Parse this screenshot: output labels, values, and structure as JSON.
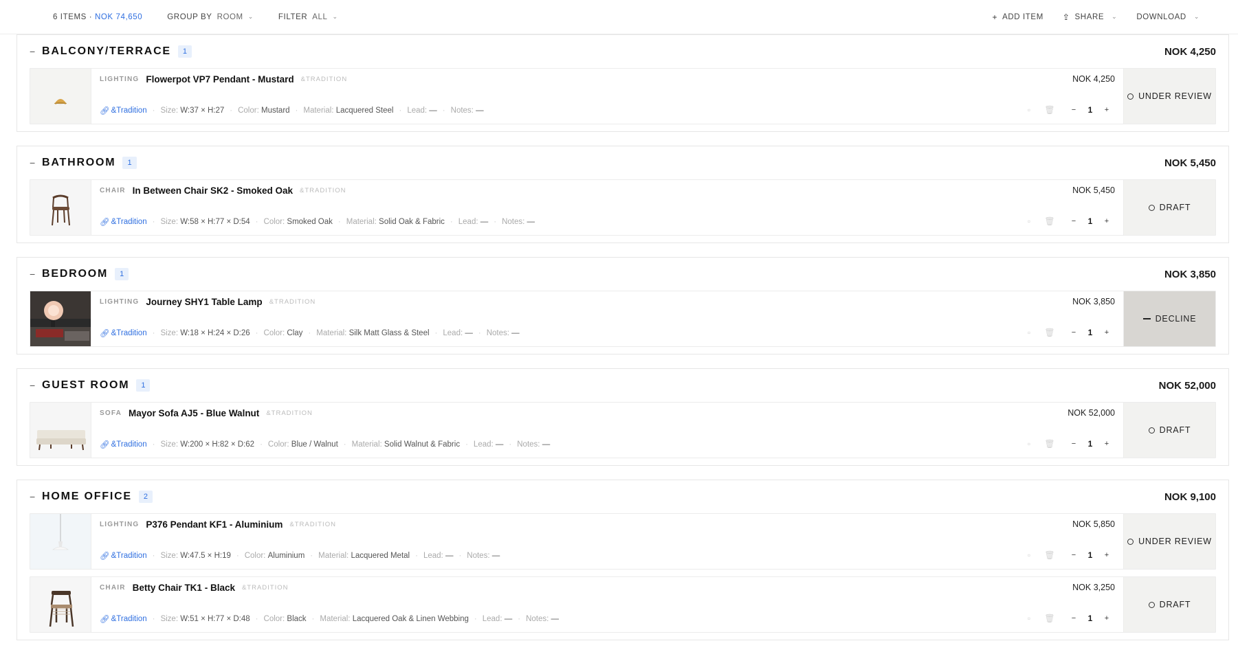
{
  "toolbar": {
    "count": "6 ITEMS · ",
    "total": "NOK 74,650",
    "group_label": "GROUP BY",
    "group_value": "ROOM",
    "filter_label": "FILTER",
    "filter_value": "ALL",
    "add_item": "ADD ITEM",
    "share": "SHARE",
    "download": "DOWNLOAD"
  },
  "rooms": [
    {
      "name": "BALCONY/TERRACE",
      "count": "1",
      "total": "NOK 4,250",
      "items": [
        {
          "category": "LIGHTING",
          "name": "Flowerpot VP7 Pendant - Mustard",
          "brand_tag": "&TRADITION",
          "price": "NOK 4,250",
          "brand": "&Tradition",
          "size": "W:37 × H:27",
          "color": "Mustard",
          "material": "Lacquered Steel",
          "lead": "—",
          "notes": "—",
          "qty": "1",
          "status": "UNDER REVIEW",
          "status_type": "dot",
          "thumb": "pendant-mustard"
        }
      ]
    },
    {
      "name": "BATHROOM",
      "count": "1",
      "total": "NOK 5,450",
      "items": [
        {
          "category": "CHAIR",
          "name": "In Between Chair SK2 - Smoked Oak",
          "brand_tag": "&TRADITION",
          "price": "NOK 5,450",
          "brand": "&Tradition",
          "size": "W:58 × H:77 × D:54",
          "color": "Smoked Oak",
          "material": "Solid Oak & Fabric",
          "lead": "—",
          "notes": "—",
          "qty": "1",
          "status": "DRAFT",
          "status_type": "dot",
          "thumb": "chair-oak"
        }
      ]
    },
    {
      "name": "BEDROOM",
      "count": "1",
      "total": "NOK 3,850",
      "items": [
        {
          "category": "LIGHTING",
          "name": "Journey SHY1 Table Lamp",
          "brand_tag": "&TRADITION",
          "price": "NOK 3,850",
          "brand": "&Tradition",
          "size": "W:18 × H:24 × D:26",
          "color": "Clay",
          "material": "Silk Matt Glass & Steel",
          "lead": "—",
          "notes": "—",
          "qty": "1",
          "status": "DECLINE",
          "status_type": "dash",
          "thumb": "table-lamp"
        }
      ]
    },
    {
      "name": "GUEST ROOM",
      "count": "1",
      "total": "NOK 52,000",
      "items": [
        {
          "category": "SOFA",
          "name": "Mayor Sofa AJ5 - Blue Walnut",
          "brand_tag": "&TRADITION",
          "price": "NOK 52,000",
          "brand": "&Tradition",
          "size": "W:200 × H:82 × D:62",
          "color": "Blue / Walnut",
          "material": "Solid Walnut & Fabric",
          "lead": "—",
          "notes": "—",
          "qty": "1",
          "status": "DRAFT",
          "status_type": "dot",
          "thumb": "sofa"
        }
      ]
    },
    {
      "name": "HOME OFFICE",
      "count": "2",
      "total": "NOK 9,100",
      "items": [
        {
          "category": "LIGHTING",
          "name": "P376 Pendant KF1 - Aluminium",
          "brand_tag": "&TRADITION",
          "price": "NOK 5,850",
          "brand": "&Tradition",
          "size": "W:47.5 × H:19",
          "color": "Aluminium",
          "material": "Lacquered Metal",
          "lead": "—",
          "notes": "—",
          "qty": "1",
          "status": "UNDER REVIEW",
          "status_type": "dot",
          "thumb": "pendant-white"
        },
        {
          "category": "CHAIR",
          "name": "Betty Chair TK1 - Black",
          "brand_tag": "&TRADITION",
          "price": "NOK 3,250",
          "brand": "&Tradition",
          "size": "W:51 × H:77 × D:48",
          "color": "Black",
          "material": "Lacquered Oak & Linen Webbing",
          "lead": "—",
          "notes": "—",
          "qty": "1",
          "status": "DRAFT",
          "status_type": "dot",
          "thumb": "chair-black"
        }
      ]
    }
  ],
  "labels": {
    "size": "Size:",
    "color": "Color:",
    "material": "Material:",
    "lead": "Lead:",
    "notes": "Notes:"
  }
}
